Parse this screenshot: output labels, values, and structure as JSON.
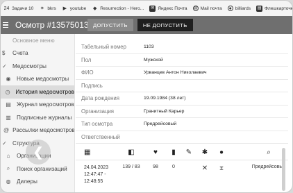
{
  "bookmarks": [
    {
      "icon": "hash-icon",
      "glyph": "24",
      "label": "Задачи 10"
    },
    {
      "icon": "figure-icon",
      "glyph": "✶",
      "label": "bkrs"
    },
    {
      "icon": "youtube-icon",
      "glyph": "▶",
      "label": "youtube"
    },
    {
      "icon": "shield-icon",
      "glyph": "◆",
      "label": "Resurrection - Hero..."
    },
    {
      "icon": "yandex-mail-icon",
      "glyph": "✉",
      "label": "Яндекс Почта"
    },
    {
      "icon": "mail-icon",
      "glyph": "✉",
      "label": "Mail почта"
    },
    {
      "icon": "billiards-icon",
      "glyph": "●",
      "label": "billiards"
    },
    {
      "icon": "flash-icon",
      "glyph": "▤",
      "label": "Флешкарточки"
    }
  ],
  "header": {
    "title": "Осмотр #13575013",
    "allow_label": "ДОПУСТИТЬ",
    "deny_label": "НЕ ДОПУСТИТЬ"
  },
  "sidebar": {
    "items": [
      {
        "label": "Основное меню",
        "icon": "",
        "level": 0,
        "dim": true
      },
      {
        "label": "Счета",
        "icon": "$",
        "level": 0
      },
      {
        "label": "Медосмотры",
        "icon": "✓",
        "level": 0,
        "caret": true
      },
      {
        "label": "Новые медосмотры",
        "icon": "◉",
        "level": 1
      },
      {
        "label": "История медосмотров",
        "icon": "◷",
        "level": 1,
        "active": true
      },
      {
        "label": "Журнал медосмотров",
        "icon": "▤",
        "level": 1
      },
      {
        "label": "Подписные журналы",
        "icon": "▥",
        "level": 1
      },
      {
        "label": "Рассылки медосмотров",
        "icon": "@",
        "level": 1
      },
      {
        "label": "Структура",
        "icon": "✓",
        "level": 0,
        "caret": true
      },
      {
        "label": "Организации",
        "icon": "⌂",
        "level": 1
      },
      {
        "label": "Поиск организаций",
        "icon": "⌕",
        "level": 1
      },
      {
        "label": "Дилеры",
        "icon": "◍",
        "level": 1
      }
    ]
  },
  "details": {
    "fields": [
      {
        "label": "Табельный номер",
        "value": "1103"
      },
      {
        "label": "Пол",
        "value": "Мужской"
      },
      {
        "label": "ФИО",
        "value": "Урванцев Антон Николаевич"
      },
      {
        "label": "Подпись",
        "value": ""
      },
      {
        "label": "Дата рождения",
        "value": "19.09.1984 (38 лет)"
      },
      {
        "label": "Организация",
        "value": "Гранитный Карьер"
      },
      {
        "label": "Тип осмотра",
        "value": "Предрейсовый"
      },
      {
        "label": "Ответственный",
        "value": ""
      }
    ]
  },
  "table": {
    "columns": [
      {
        "icon": "calendar-icon",
        "glyph": "▦"
      },
      {
        "icon": "pressure-icon",
        "glyph": "◧"
      },
      {
        "icon": "heart-icon",
        "glyph": "♥"
      },
      {
        "icon": "breathalyzer-icon",
        "glyph": "▮"
      },
      {
        "icon": "pen-icon",
        "glyph": "✎"
      },
      {
        "icon": "alcohol-icon",
        "glyph": "✱"
      },
      {
        "icon": "person-icon",
        "glyph": "●"
      },
      {
        "icon": "search-icon",
        "glyph": "⌕"
      }
    ],
    "row": {
      "date_line1": "24.04.2023",
      "date_line2": "12:47:47 -",
      "date_line3": "12:48:55",
      "pressure": "139 / 83",
      "pulse": "98",
      "alcohol": "0",
      "mark": "✕",
      "status_glyph": "⧗",
      "type": "Предрейсовый"
    }
  }
}
